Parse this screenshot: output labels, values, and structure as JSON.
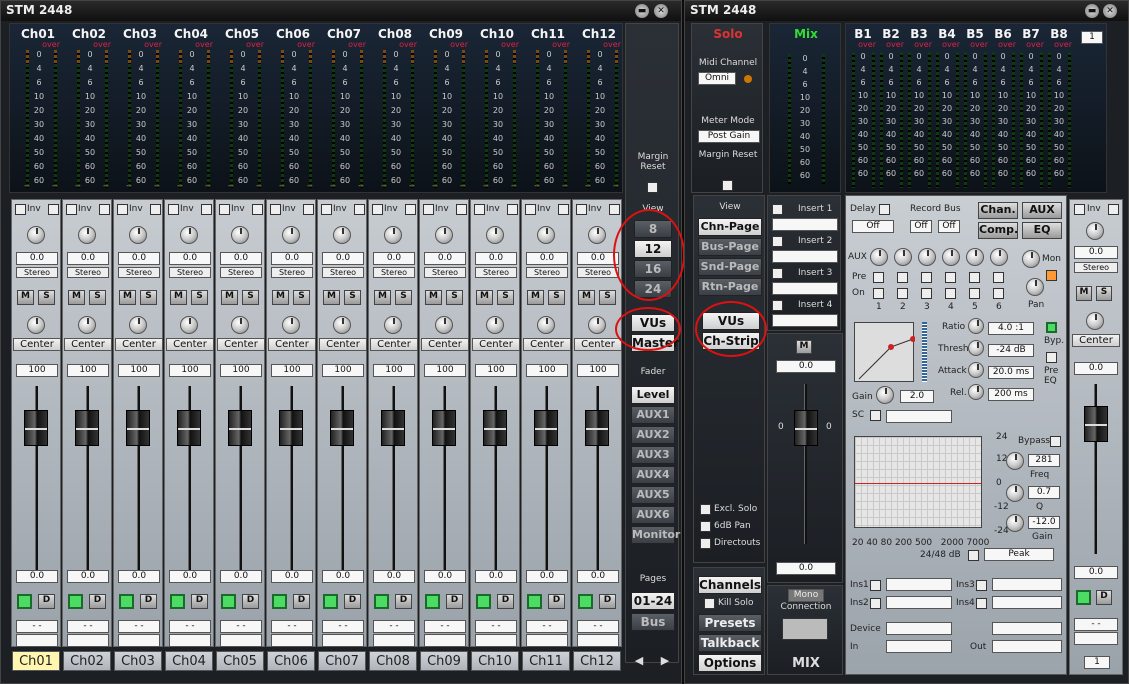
{
  "left": {
    "title": "STM 2448",
    "channels": [
      "Ch01",
      "Ch02",
      "Ch03",
      "Ch04",
      "Ch05",
      "Ch06",
      "Ch07",
      "Ch08",
      "Ch09",
      "Ch10",
      "Ch11",
      "Ch12"
    ],
    "over": "over",
    "scale": [
      "0",
      "4",
      "6",
      "10",
      "20",
      "30",
      "40",
      "50",
      "60",
      "60"
    ],
    "gain_value": "0.0",
    "stereo": "Stereo",
    "inv": "Inv",
    "mute": "M",
    "solo": "S",
    "pan": "Center",
    "level_top": "100",
    "fader_value": "0.0",
    "d": "D",
    "dash": "- -",
    "selected": "Ch01"
  },
  "side": {
    "margin_reset": "Margin Reset",
    "view": "View",
    "views": [
      "8",
      "12",
      "16",
      "24"
    ],
    "selected_view": "12",
    "vus": "VUs",
    "master": "Master",
    "fader": "Fader",
    "fader_modes": [
      "Level",
      "AUX1",
      "AUX2",
      "AUX3",
      "AUX4",
      "AUX5",
      "AUX6",
      "Monitor"
    ],
    "selected_mode": "Level",
    "pages": "Pages",
    "page_value": "01-24",
    "bus": "Bus",
    "prev": "◀",
    "next": "▶"
  },
  "right": {
    "title": "STM 2448",
    "solo": "Solo",
    "midi_channel": "Midi Channel",
    "omni": "Omni",
    "meter_mode": "Meter Mode",
    "post_gain": "Post Gain",
    "margin_reset": "Margin Reset",
    "mix": "Mix",
    "buses": [
      "B1",
      "B2",
      "B3",
      "B4",
      "B5",
      "B6",
      "B7",
      "B8"
    ],
    "bus_num": "1",
    "view": "View",
    "pages": [
      "Chn-Page",
      "Bus-Page",
      "Snd-Page",
      "Rtn-Page"
    ],
    "vus": "VUs",
    "chstrip": "Ch-Strip",
    "inserts": [
      "Insert 1",
      "Insert 2",
      "Insert 3",
      "Insert 4"
    ],
    "excl_solo": "Excl. Solo",
    "pan6db": "6dB Pan",
    "direct_outs": "Directouts",
    "channels": "Channels",
    "kill_solo": "Kill Solo",
    "presets": "Presets",
    "talkback": "Talkback",
    "options": "Options",
    "m": "M",
    "master_top": "0.0",
    "master_bottom": "0.0",
    "mono": "Mono",
    "connection": "Connection",
    "mixlabel": "MIX",
    "delay": "Delay",
    "delay_val": "Off",
    "record_bus": "Record Bus",
    "off1": "Off",
    "off2": "Off",
    "chan": "Chan.",
    "aux": "AUX",
    "comp": "Comp.",
    "eq": "EQ",
    "aux_label": "AUX",
    "mon": "Mon",
    "pre": "Pre",
    "on": "On",
    "pan": "Pan",
    "aux_nums": [
      "1",
      "2",
      "3",
      "4",
      "5",
      "6"
    ],
    "ratio": "Ratio",
    "ratio_val": "4.0 :1",
    "thresh": "Thresh.",
    "thresh_val": "-24 dB",
    "attack": "Attack",
    "attack_val": "20.0 ms",
    "rel": "Rel.",
    "rel_val": "200 ms",
    "gain": "Gain",
    "gain_val": "2.0",
    "sc": "SC",
    "byp": "Byp.",
    "preeq": "Pre EQ",
    "bypass": "Bypass",
    "freq": "Freq",
    "freq_val": "281",
    "q": "Q",
    "q_val": "0.7",
    "eqgain": "Gain",
    "eqgain_val": "-12.0",
    "eq_db": [
      "24",
      "12",
      "0",
      "-12",
      "-24"
    ],
    "eq_freqs": "20 40 80 200 500   2000 7000",
    "eq_mode": "24/48 dB",
    "peak": "Peak",
    "ins1": "Ins1",
    "ins2": "Ins2",
    "ins3": "Ins3",
    "ins4": "Ins4",
    "device": "Device",
    "in": "In",
    "out": "Out",
    "inv": "Inv",
    "stereo": "Stereo",
    "center": "Center",
    "small_top": "0.0",
    "small_bottom": "0.0",
    "d": "D",
    "num1": "1"
  }
}
